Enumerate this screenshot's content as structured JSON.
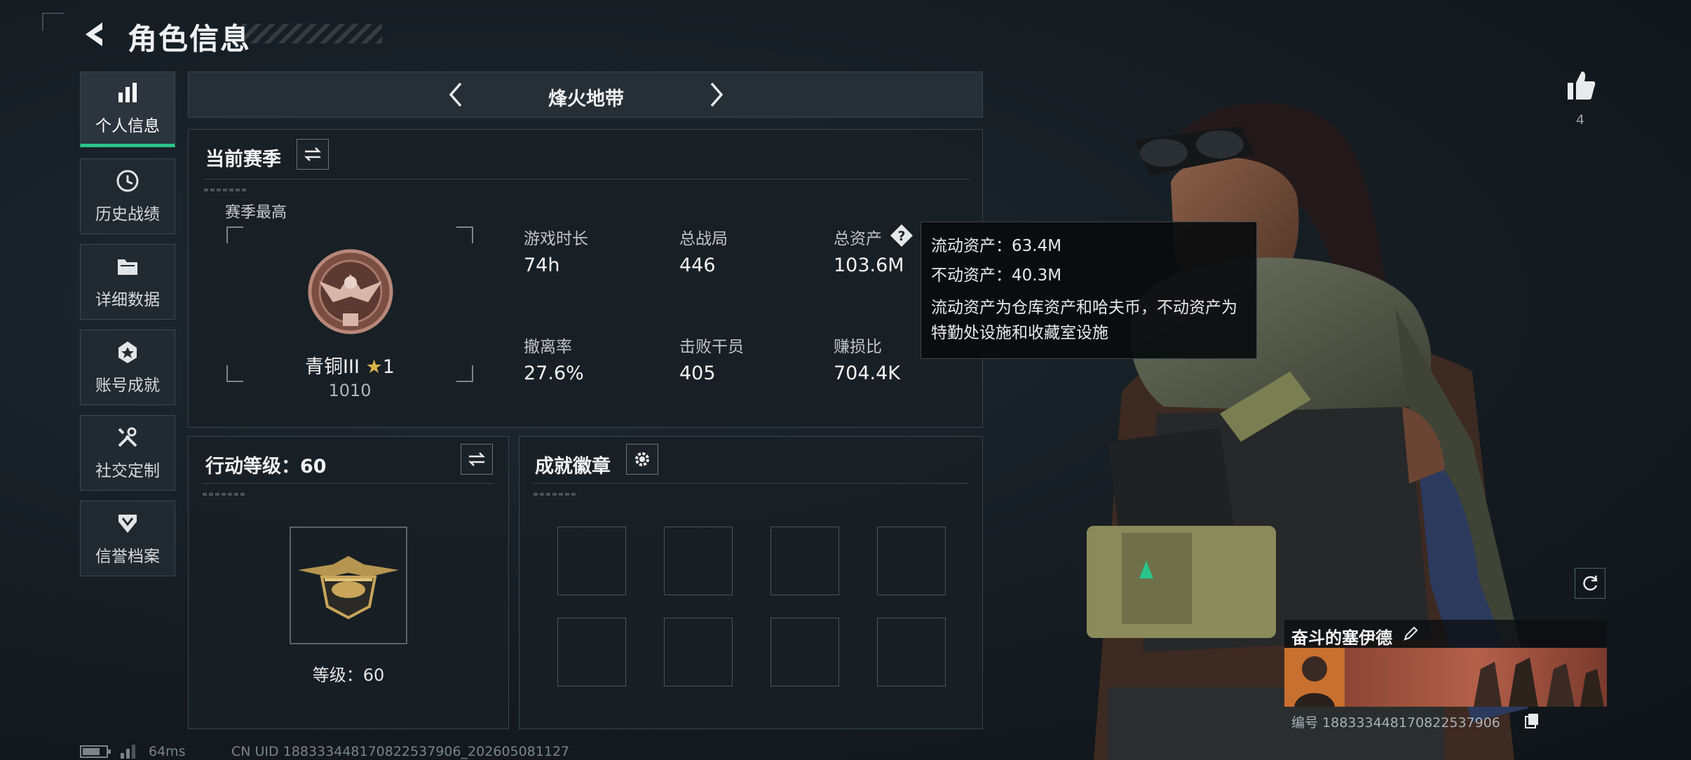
{
  "header": {
    "title": "角色信息"
  },
  "sidebar": {
    "items": [
      {
        "label": "个人信息",
        "icon": "bar-chart-icon",
        "active": true
      },
      {
        "label": "历史战绩",
        "icon": "history-clock-icon",
        "active": false
      },
      {
        "label": "详细数据",
        "icon": "folder-icon",
        "active": false
      },
      {
        "label": "账号成就",
        "icon": "achievement-icon",
        "active": false
      },
      {
        "label": "社交定制",
        "icon": "tools-icon",
        "active": false
      },
      {
        "label": "信誉档案",
        "icon": "shield-badge-icon",
        "active": false
      }
    ]
  },
  "mode": {
    "title": "烽火地带"
  },
  "season": {
    "title": "当前赛季",
    "highest_label": "赛季最高",
    "rank_name": "青铜III",
    "rank_stars": "1",
    "rank_score": "1010",
    "stats": [
      {
        "label": "游戏时长",
        "value": "74h"
      },
      {
        "label": "总战局",
        "value": "446"
      },
      {
        "label": "总资产",
        "value": "103.6M"
      },
      {
        "label": "撤离率",
        "value": "27.6%"
      },
      {
        "label": "击败干员",
        "value": "405"
      },
      {
        "label": "赚损比",
        "value": "704.4K"
      }
    ]
  },
  "tooltip": {
    "liquid": "流动资产：63.4M",
    "fixed": "不动资产：40.3M",
    "description": "流动资产为仓库资产和哈夫币，不动资产为特勤处设施和收藏室设施"
  },
  "action_level": {
    "title": "行动等级：60",
    "level_text": "等级：60"
  },
  "achievements": {
    "title": "成就徽章",
    "slot_count": 8
  },
  "profile": {
    "likes": "4",
    "name": "奋斗的塞伊德",
    "id_text": "编号 1883334481708225379​06"
  },
  "footer": {
    "ping": "64ms",
    "uid": "CN UID 1883334481708225379​06_202605081127"
  },
  "colors": {
    "accent_green": "#29c48a",
    "star_gold": "#d9b24a"
  }
}
